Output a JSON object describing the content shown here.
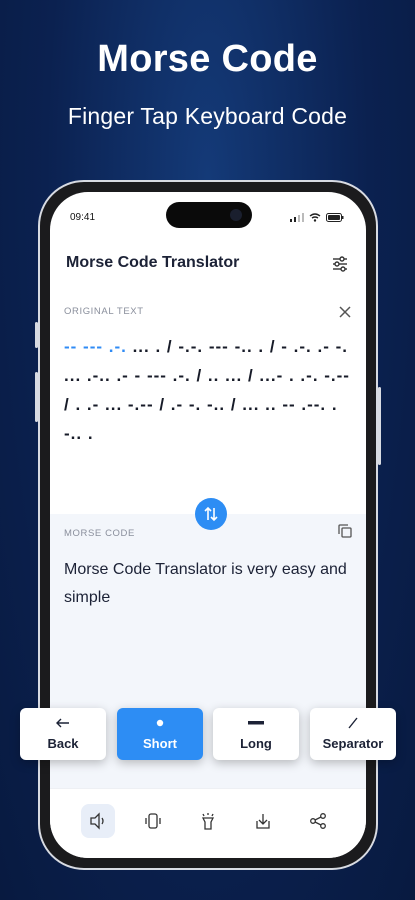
{
  "promo": {
    "headline": "Morse Code",
    "subline": "Finger Tap Keyboard Code"
  },
  "status_bar": {
    "time": "09:41"
  },
  "app_bar": {
    "title": "Morse Code Translator",
    "settings_icon": "sliders-icon"
  },
  "original": {
    "label": "ORIGINAL TEXT",
    "highlight": "-- --- .-.",
    "rest": " ... . / -.-. --- -.. . / - .-. .- -. ... .-.. .- - --- .-. / .. ... / ...- . .-. -.-- / . .- ... -.-- / .- -. -.. / ... .. -- .--. .-.. ."
  },
  "morse": {
    "label": "MORSE CODE",
    "text": "Morse Code Translator is very easy and simple"
  },
  "keys": [
    {
      "label": "Back",
      "icon": "arrow-left-icon"
    },
    {
      "label": "Short",
      "icon": "dot-icon"
    },
    {
      "label": "Long",
      "icon": "dash-icon"
    },
    {
      "label": "Separator",
      "icon": "slash-icon"
    }
  ],
  "bottom_bar": [
    "speaker-icon",
    "vibrate-icon",
    "flashlight-icon",
    "download-icon",
    "share-icon"
  ],
  "colors": {
    "accent": "#2d8df4",
    "background": "#0b2150"
  }
}
